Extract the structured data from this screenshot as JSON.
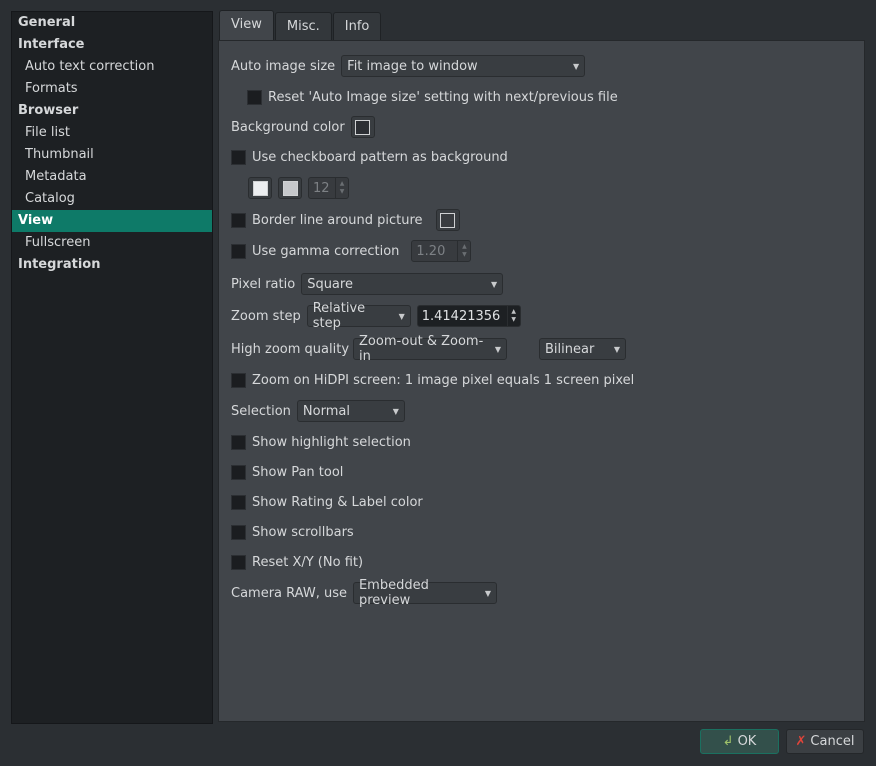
{
  "sidebar": {
    "items": [
      {
        "label": "General",
        "type": "h"
      },
      {
        "label": "Interface",
        "type": "h"
      },
      {
        "label": "Auto text correction",
        "type": "c"
      },
      {
        "label": "Formats",
        "type": "c"
      },
      {
        "label": "Browser",
        "type": "h"
      },
      {
        "label": "File list",
        "type": "c"
      },
      {
        "label": "Thumbnail",
        "type": "c"
      },
      {
        "label": "Metadata",
        "type": "c"
      },
      {
        "label": "Catalog",
        "type": "c"
      },
      {
        "label": "View",
        "type": "h",
        "selected": true
      },
      {
        "label": "Fullscreen",
        "type": "c"
      },
      {
        "label": "Integration",
        "type": "h"
      }
    ]
  },
  "tabs": [
    "View",
    "Misc.",
    "Info"
  ],
  "view": {
    "auto_image_size_label": "Auto image size",
    "auto_image_size_value": "Fit image to window",
    "reset_auto": "Reset 'Auto Image size' setting with next/previous file",
    "bg_color_label": "Background color",
    "checkboard": "Use checkboard pattern as background",
    "checkboard_size": "12",
    "border_line": "Border line around picture",
    "gamma": "Use gamma correction",
    "gamma_value": "1.20",
    "pixel_ratio_label": "Pixel ratio",
    "pixel_ratio_value": "Square",
    "zoom_step_label": "Zoom step",
    "zoom_step_value": "Relative step",
    "zoom_step_number": "1.41421356",
    "high_zoom_label": "High zoom quality",
    "high_zoom_value": "Zoom-out & Zoom-in",
    "high_zoom_filter": "Bilinear",
    "hidpi": "Zoom on HiDPI screen: 1 image pixel equals 1 screen pixel",
    "selection_label": "Selection",
    "selection_value": "Normal",
    "highlight": "Show highlight selection",
    "pan": "Show Pan tool",
    "rating": "Show Rating & Label color",
    "scrollbars": "Show scrollbars",
    "reset_xy": "Reset X/Y (No fit)",
    "raw_label": "Camera RAW, use",
    "raw_value": "Embedded preview"
  },
  "buttons": {
    "ok": "OK",
    "cancel": "Cancel"
  }
}
